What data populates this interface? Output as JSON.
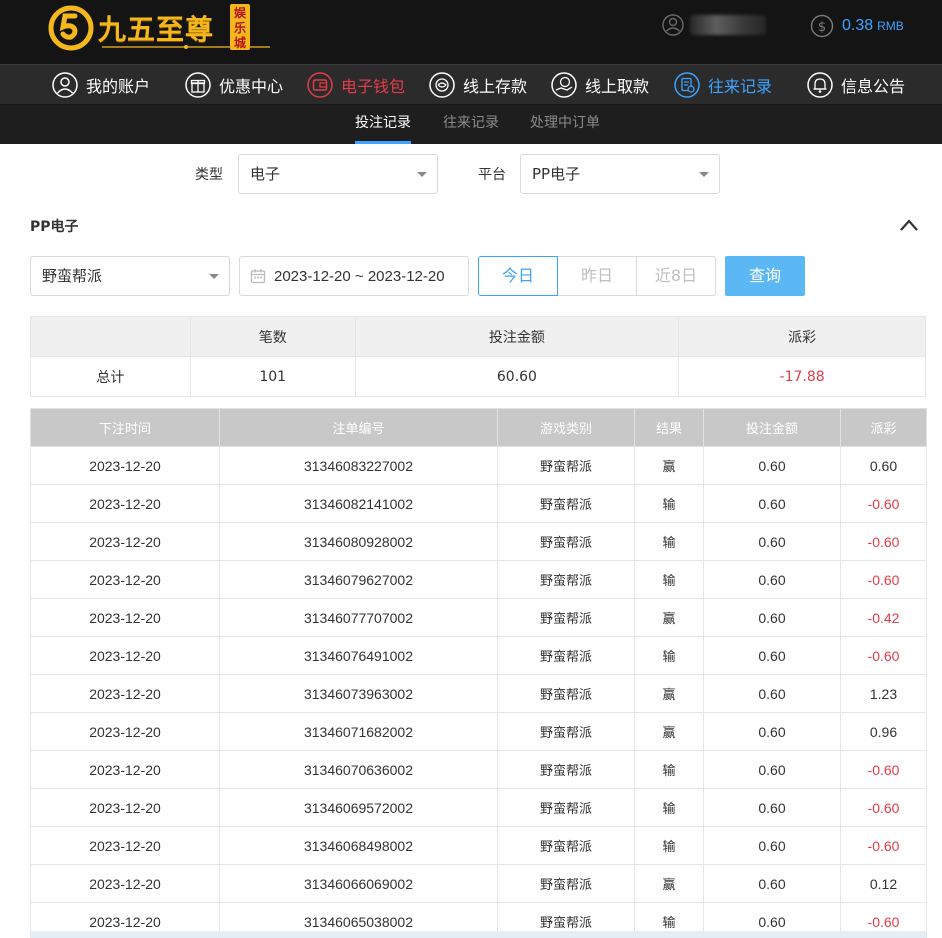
{
  "brand": {
    "title": "九五至尊",
    "badge": "娱乐城",
    "mark_color": "#f4b81d"
  },
  "balance": {
    "amount": "0.38",
    "unit": "RMB"
  },
  "nav": [
    {
      "label": "我的账户",
      "icon": "user-icon",
      "state": "normal"
    },
    {
      "label": "优惠中心",
      "icon": "gift-icon",
      "state": "normal"
    },
    {
      "label": "电子钱包",
      "icon": "wallet-icon",
      "state": "red"
    },
    {
      "label": "线上存款",
      "icon": "deposit-icon",
      "state": "normal"
    },
    {
      "label": "线上取款",
      "icon": "withdraw-icon",
      "state": "normal"
    },
    {
      "label": "往来记录",
      "icon": "record-icon",
      "state": "active"
    },
    {
      "label": "信息公告",
      "icon": "bell-icon",
      "state": "normal"
    }
  ],
  "subnav": [
    {
      "label": "投注记录",
      "active": true
    },
    {
      "label": "往来记录",
      "active": false
    },
    {
      "label": "处理中订单",
      "active": false
    }
  ],
  "filters": {
    "type_label": "类型",
    "type_value": "电子",
    "platform_label": "平台",
    "platform_value": "PP电子"
  },
  "section": {
    "title": "PP电子"
  },
  "game_select": "野蛮帮派",
  "date_range": "2023-12-20 ~ 2023-12-20",
  "ranges": [
    "今日",
    "昨日",
    "近8日"
  ],
  "query_label": "查询",
  "summary": {
    "headers": [
      "",
      "笔数",
      "投注金额",
      "派彩"
    ],
    "row": [
      "总计",
      "101",
      "60.60",
      "-17.88"
    ]
  },
  "records": {
    "headers": [
      "下注时间",
      "注单编号",
      "游戏类别",
      "结果",
      "投注金额",
      "派彩"
    ],
    "rows": [
      [
        "2023-12-20",
        "31346083227002",
        "野蛮帮派",
        "赢",
        "0.60",
        "0.60"
      ],
      [
        "2023-12-20",
        "31346082141002",
        "野蛮帮派",
        "输",
        "0.60",
        "-0.60"
      ],
      [
        "2023-12-20",
        "31346080928002",
        "野蛮帮派",
        "输",
        "0.60",
        "-0.60"
      ],
      [
        "2023-12-20",
        "31346079627002",
        "野蛮帮派",
        "输",
        "0.60",
        "-0.60"
      ],
      [
        "2023-12-20",
        "31346077707002",
        "野蛮帮派",
        "赢",
        "0.60",
        "-0.42"
      ],
      [
        "2023-12-20",
        "31346076491002",
        "野蛮帮派",
        "输",
        "0.60",
        "-0.60"
      ],
      [
        "2023-12-20",
        "31346073963002",
        "野蛮帮派",
        "赢",
        "0.60",
        "1.23"
      ],
      [
        "2023-12-20",
        "31346071682002",
        "野蛮帮派",
        "赢",
        "0.60",
        "0.96"
      ],
      [
        "2023-12-20",
        "31346070636002",
        "野蛮帮派",
        "输",
        "0.60",
        "-0.60"
      ],
      [
        "2023-12-20",
        "31346069572002",
        "野蛮帮派",
        "输",
        "0.60",
        "-0.60"
      ],
      [
        "2023-12-20",
        "31346068498002",
        "野蛮帮派",
        "输",
        "0.60",
        "-0.60"
      ],
      [
        "2023-12-20",
        "31346066069002",
        "野蛮帮派",
        "赢",
        "0.60",
        "0.12"
      ],
      [
        "2023-12-20",
        "31346065038002",
        "野蛮帮派",
        "输",
        "0.60",
        "-0.60"
      ]
    ]
  },
  "colors": {
    "accent": "#3ea3ff",
    "negative": "#e33c4a",
    "brand_gold": "#f4b81d"
  }
}
